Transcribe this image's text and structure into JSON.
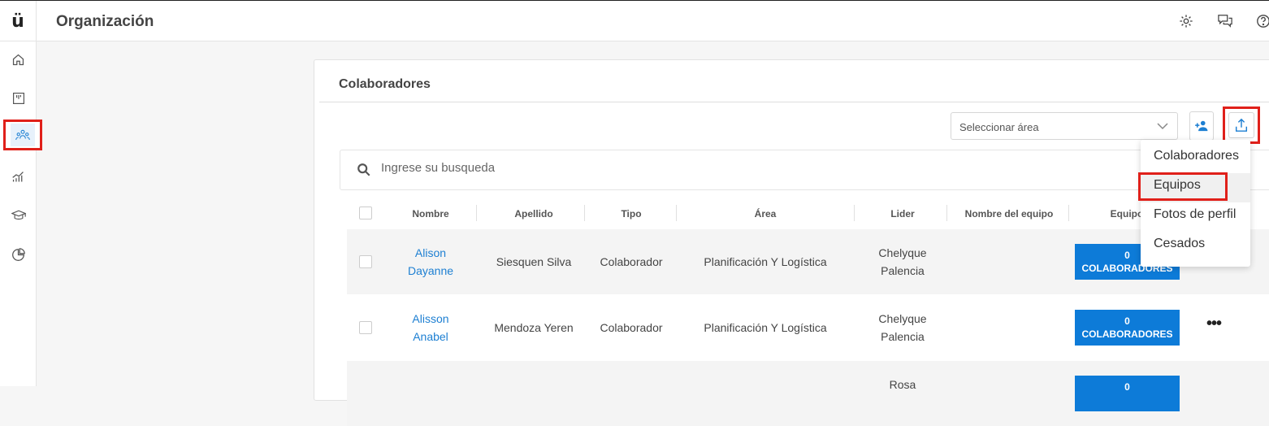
{
  "app": {
    "logo": "ü",
    "title": "Organización"
  },
  "header_icons": [
    "gear-icon",
    "chat-icon",
    "help-icon"
  ],
  "sidebar": {
    "items": [
      {
        "icon": "home-icon"
      },
      {
        "icon": "board-icon"
      },
      {
        "icon": "people-icon",
        "active": true
      },
      {
        "icon": "growth-chart-icon"
      },
      {
        "icon": "graduation-cap-icon"
      },
      {
        "icon": "pie-chart-icon"
      }
    ]
  },
  "card": {
    "title": "Colaboradores",
    "area_select_placeholder": "Seleccionar área",
    "search_placeholder": "Ingrese su busqueda"
  },
  "table": {
    "headers": [
      "Nombre",
      "Apellido",
      "Tipo",
      "Área",
      "Lider",
      "Nombre del equipo",
      "Equipo"
    ],
    "rows": [
      {
        "nombre": [
          "Alison",
          "Dayanne"
        ],
        "apellido": "Siesquen Silva",
        "tipo": "Colaborador",
        "area": "Planificación Y Logística",
        "lider": [
          "Chelyque",
          "Palencia"
        ],
        "equipo_count": "0",
        "equipo_label": "COLABORADORES"
      },
      {
        "nombre": [
          "Alisson",
          "Anabel"
        ],
        "apellido": "Mendoza Yeren",
        "tipo": "Colaborador",
        "area": "Planificación Y Logística",
        "lider": [
          "Chelyque",
          "Palencia"
        ],
        "equipo_count": "0",
        "equipo_label": "COLABORADORES"
      },
      {
        "lider": [
          "Rosa"
        ],
        "equipo_count": "0"
      }
    ]
  },
  "export_menu": {
    "items": [
      "Colaboradores",
      "Equipos",
      "Fotos de perfil",
      "Cesados"
    ]
  },
  "colors": {
    "accent": "#0d7bd8",
    "highlight": "#e0201a",
    "link": "#1d7fd2"
  }
}
